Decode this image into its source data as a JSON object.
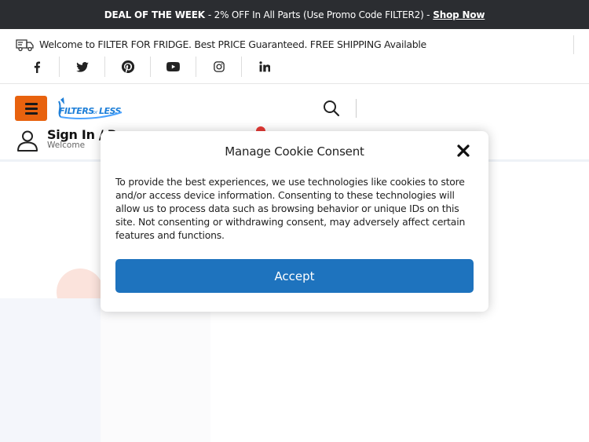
{
  "promo_bar": {
    "deal_label": "DEAL OF THE WEEK",
    "deal_text": "- 2% OFF In All Parts (Use Promo Code FILTER2) -",
    "shop_now": "Shop Now"
  },
  "info_bar": {
    "welcome_text": "Welcome to FILTER FOR FRIDGE. Best PRICE Guaranteed. FREE SHIPPING Available",
    "icon": "truck-icon"
  },
  "social_links": [
    {
      "name": "facebook-icon"
    },
    {
      "name": "twitter-icon"
    },
    {
      "name": "pinterest-icon"
    },
    {
      "name": "youtube-icon"
    },
    {
      "name": "instagram-icon"
    },
    {
      "name": "linkedin-icon"
    }
  ],
  "header": {
    "menu_icon": "hamburger-icon",
    "logo_alt": "FILTERSforLESS",
    "search_icon": "search-icon",
    "account": {
      "label": "Sign In / R",
      "sub": "Welcome"
    }
  },
  "cookie_modal": {
    "title": "Manage Cookie Consent",
    "body": "To provide the best experiences, we use technologies like cookies to store and/or access device information. Consenting to these technologies will allow us to process data such as browsing behavior or unique IDs on this site. Not consenting or withdrawing consent, may adversely affect certain features and functions.",
    "accept_label": "Accept"
  },
  "colors": {
    "promo_bg": "#2b2d31",
    "menu_button": "#e8620e",
    "accept_button": "#1e73be",
    "badge": "#e53935"
  }
}
